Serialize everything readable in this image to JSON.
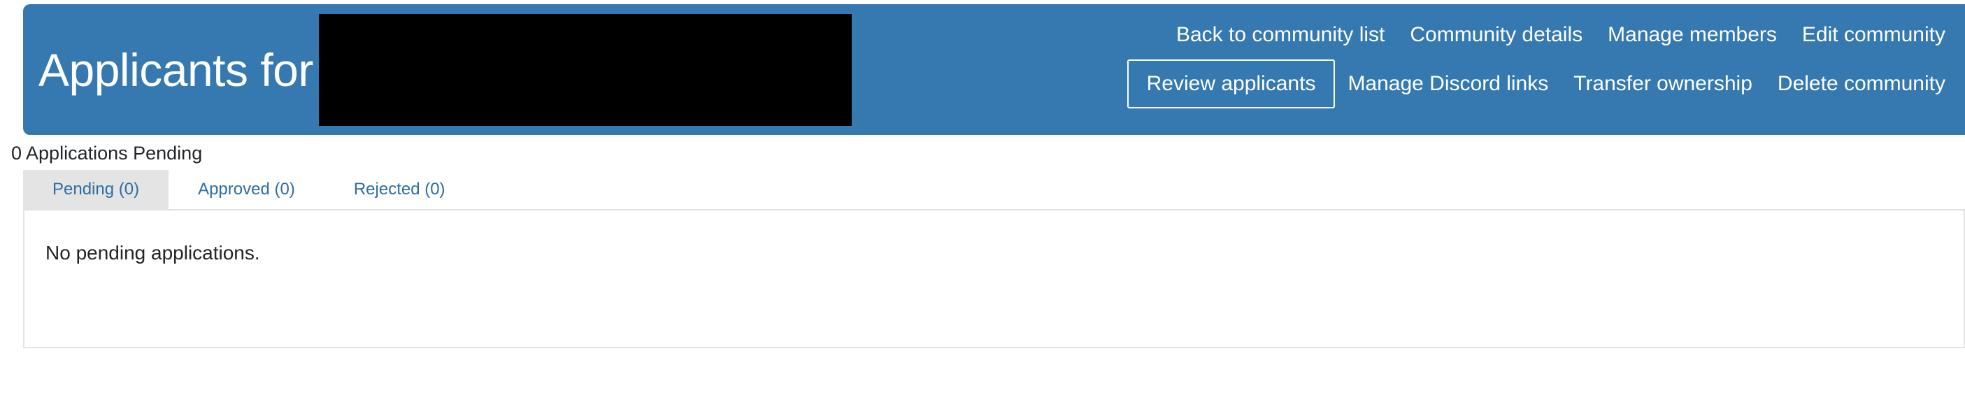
{
  "header": {
    "title": "Applicants for",
    "redacted_name": "",
    "background_color": "#3579b0",
    "nav_rows": [
      [
        {
          "label": "Back to community list",
          "name": "nav-back-to-community-list",
          "active": false
        },
        {
          "label": "Community details",
          "name": "nav-community-details",
          "active": false
        },
        {
          "label": "Manage members",
          "name": "nav-manage-members",
          "active": false
        },
        {
          "label": "Edit community",
          "name": "nav-edit-community",
          "active": false
        }
      ],
      [
        {
          "label": "Review applicants",
          "name": "nav-review-applicants",
          "active": true
        },
        {
          "label": "Manage Discord links",
          "name": "nav-manage-discord-links",
          "active": false
        },
        {
          "label": "Transfer ownership",
          "name": "nav-transfer-ownership",
          "active": false
        },
        {
          "label": "Delete community",
          "name": "nav-delete-community",
          "active": false
        }
      ]
    ]
  },
  "sub_heading": "0 Applications Pending",
  "tabs": [
    {
      "label": "Pending (0)",
      "name": "tab-pending",
      "active": true
    },
    {
      "label": "Approved (0)",
      "name": "tab-approved",
      "active": false
    },
    {
      "label": "Rejected (0)",
      "name": "tab-rejected",
      "active": false
    }
  ],
  "panel": {
    "message": "No pending applications."
  },
  "colors": {
    "header_blue": "#3579b0",
    "tab_link": "#2e6da4",
    "active_tab_bg": "#e4e4e4",
    "panel_border": "#e4e4e4"
  }
}
